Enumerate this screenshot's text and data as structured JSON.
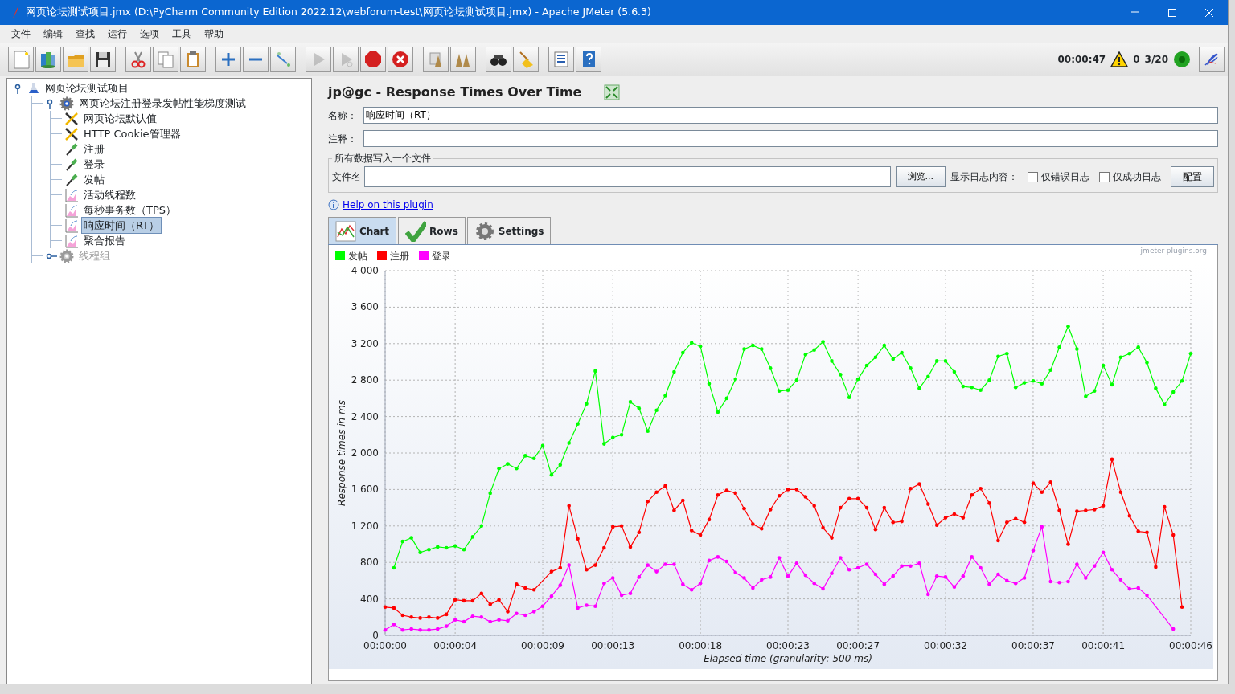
{
  "window": {
    "title": "网页论坛测试项目.jmx (D:\\PyCharm Community Edition 2022.12\\webforum-test\\网页论坛测试项目.jmx) - Apache JMeter (5.6.3)"
  },
  "menu": [
    "文件",
    "编辑",
    "查找",
    "运行",
    "选项",
    "工具",
    "帮助"
  ],
  "toolbar": [
    {
      "buttons": [
        {
          "kind": "new",
          "disabled": false
        },
        {
          "kind": "templates",
          "disabled": false
        },
        {
          "kind": "open",
          "disabled": false
        },
        {
          "kind": "save",
          "disabled": false
        }
      ]
    },
    {
      "buttons": [
        {
          "kind": "cut",
          "disabled": false
        },
        {
          "kind": "copy",
          "disabled": false
        },
        {
          "kind": "paste",
          "disabled": false
        }
      ]
    },
    {
      "buttons": [
        {
          "kind": "expand",
          "disabled": false
        },
        {
          "kind": "collapse",
          "disabled": false
        },
        {
          "kind": "toggle",
          "disabled": false
        }
      ]
    },
    {
      "buttons": [
        {
          "kind": "start",
          "disabled": true
        },
        {
          "kind": "start-no-pause",
          "disabled": true
        },
        {
          "kind": "stop",
          "disabled": false
        },
        {
          "kind": "shutdown",
          "disabled": false
        }
      ]
    },
    {
      "buttons": [
        {
          "kind": "clear",
          "disabled": false
        },
        {
          "kind": "clear-all",
          "disabled": false
        }
      ]
    },
    {
      "buttons": [
        {
          "kind": "search",
          "disabled": false
        },
        {
          "kind": "reset-search",
          "disabled": false
        }
      ]
    },
    {
      "buttons": [
        {
          "kind": "functions",
          "disabled": false
        },
        {
          "kind": "help",
          "disabled": false
        }
      ]
    }
  ],
  "status": {
    "elapsed": "00:00:47",
    "warnings": "0",
    "threads": "3/20",
    "running": true
  },
  "tree": [
    {
      "label": "网页论坛测试项目",
      "kind": "test-plan",
      "expanded": true,
      "selected": false,
      "disabled": false,
      "children": [
        {
          "label": "网页论坛注册登录发帖性能梯度测试",
          "kind": "thread-group",
          "expanded": true,
          "selected": false,
          "disabled": false,
          "children": [
            {
              "label": "网页论坛默认值",
              "kind": "config",
              "selected": false,
              "disabled": false
            },
            {
              "label": "HTTP Cookie管理器",
              "kind": "config",
              "selected": false,
              "disabled": false
            },
            {
              "label": "注册",
              "kind": "sampler",
              "selected": false,
              "disabled": false
            },
            {
              "label": "登录",
              "kind": "sampler",
              "selected": false,
              "disabled": false
            },
            {
              "label": "发帖",
              "kind": "sampler",
              "selected": false,
              "disabled": false
            },
            {
              "label": "活动线程数",
              "kind": "listener",
              "selected": false,
              "disabled": false
            },
            {
              "label": "每秒事务数（TPS）",
              "kind": "listener",
              "selected": false,
              "disabled": false
            },
            {
              "label": "响应时间（RT）",
              "kind": "listener",
              "selected": true,
              "disabled": false
            },
            {
              "label": "聚合报告",
              "kind": "listener",
              "selected": false,
              "disabled": false
            }
          ]
        },
        {
          "label": "线程组",
          "kind": "thread-group",
          "expanded": false,
          "selected": false,
          "disabled": true
        }
      ]
    }
  ],
  "panel": {
    "title": "jp@gc - Response Times Over Time",
    "name_label": "名称：",
    "name": "响应时间（RT）",
    "comment_label": "注释：",
    "file_group": {
      "legend": "所有数据写入一个文件",
      "file_label": "文件名",
      "browse_button": "浏览...",
      "log_label": "显示日志内容：",
      "options": [
        {
          "label": "仅错误日志",
          "checked": false
        },
        {
          "label": "仅成功日志",
          "checked": false
        }
      ],
      "configure_button": "配置"
    },
    "help_link": "Help on this plugin",
    "tabs": [
      {
        "label": "Chart",
        "kind": "chart",
        "selected": true
      },
      {
        "label": "Rows",
        "kind": "rows",
        "selected": false
      },
      {
        "label": "Settings",
        "kind": "settings",
        "selected": false
      }
    ],
    "chart": {
      "watermark": "jmeter-plugins.org",
      "chart_data": {
        "type": "line",
        "xlabel": "Elapsed time (granularity: 500 ms)",
        "ylabel": "Response times in ms",
        "grid": true,
        "legend": "top-left",
        "x": [
          0,
          0.5,
          1,
          1.5,
          2,
          2.5,
          3,
          3.5,
          4,
          4.5,
          5,
          5.5,
          6,
          6.5,
          7,
          7.5,
          8,
          8.5,
          9,
          9.5,
          10,
          10.5,
          11,
          11.5,
          12,
          12.5,
          13,
          13.5,
          14,
          14.5,
          15,
          15.5,
          16,
          16.5,
          17,
          17.5,
          18,
          18.5,
          19,
          19.5,
          20,
          20.5,
          21,
          21.5,
          22,
          22.5,
          23,
          23.5,
          24,
          24.5,
          25,
          25.5,
          26,
          26.5,
          27,
          27.5,
          28,
          28.5,
          29,
          29.5,
          30,
          30.5,
          31,
          31.5,
          32,
          32.5,
          33,
          33.5,
          34,
          34.5,
          35,
          35.5,
          36,
          36.5,
          37,
          37.5,
          38,
          38.5,
          39,
          39.5,
          40,
          40.5,
          41,
          41.5,
          42,
          42.5,
          43,
          43.5,
          44,
          44.5,
          45,
          45.5,
          46
        ],
        "xlim": [
          0,
          46
        ],
        "ylim": [
          0,
          4000
        ],
        "xticks": [
          {
            "value": 0,
            "label": "00:00:00"
          },
          {
            "value": 4,
            "label": "00:00:04"
          },
          {
            "value": 9,
            "label": "00:00:09"
          },
          {
            "value": 13,
            "label": "00:00:13"
          },
          {
            "value": 18,
            "label": "00:00:18"
          },
          {
            "value": 23,
            "label": "00:00:23"
          },
          {
            "value": 27,
            "label": "00:00:27"
          },
          {
            "value": 32,
            "label": "00:00:32"
          },
          {
            "value": 37,
            "label": "00:00:37"
          },
          {
            "value": 41,
            "label": "00:00:41"
          },
          {
            "value": 46,
            "label": "00:00:46"
          }
        ],
        "yticks": [
          {
            "value": 0,
            "label": "0"
          },
          {
            "value": 400,
            "label": "400"
          },
          {
            "value": 800,
            "label": "800"
          },
          {
            "value": 1200,
            "label": "1 200"
          },
          {
            "value": 1600,
            "label": "1 600"
          },
          {
            "value": 2000,
            "label": "2 000"
          },
          {
            "value": 2400,
            "label": "2 400"
          },
          {
            "value": 2800,
            "label": "2 800"
          },
          {
            "value": 3200,
            "label": "3 200"
          },
          {
            "value": 3600,
            "label": "3 600"
          },
          {
            "value": 4000,
            "label": "4 000"
          }
        ],
        "series": [
          {
            "name": "发帖",
            "color": "#00ff00",
            "values": [
              null,
              740,
              1030,
              1070,
              910,
              940,
              970,
              960,
              980,
              940,
              1080,
              1200,
              1560,
              1830,
              1880,
              1830,
              1970,
              1940,
              2080,
              1760,
              1870,
              2110,
              2320,
              2540,
              2900,
              2100,
              2170,
              2200,
              2560,
              2490,
              2240,
              2470,
              2630,
              2890,
              3100,
              3210,
              3170,
              2760,
              2450,
              2600,
              2810,
              3140,
              3180,
              3140,
              2930,
              2680,
              2690,
              2800,
              3080,
              3130,
              3220,
              3010,
              2860,
              2610,
              2810,
              2960,
              3050,
              3180,
              3030,
              3100,
              2930,
              2710,
              2840,
              3010,
              3010,
              2890,
              2730,
              2720,
              2690,
              2800,
              3060,
              3090,
              2720,
              2770,
              2790,
              2760,
              2910,
              3160,
              3390,
              3140,
              2620,
              2680,
              2960,
              2750,
              3050,
              3090,
              3160,
              2990,
              2710,
              2530,
              2670,
              2790,
              3090
            ]
          },
          {
            "name": "注册",
            "color": "#ff0000",
            "values": [
              310,
              300,
              220,
              200,
              190,
              200,
              190,
              230,
              390,
              380,
              380,
              460,
              340,
              390,
              260,
              560,
              520,
              500,
              null,
              700,
              740,
              1420,
              1060,
              720,
              770,
              960,
              1190,
              1200,
              970,
              1130,
              1470,
              1570,
              1640,
              1370,
              1480,
              1150,
              1100,
              1270,
              1540,
              1590,
              1560,
              1390,
              1220,
              1170,
              1380,
              1530,
              1600,
              1600,
              1520,
              1420,
              1180,
              1070,
              1400,
              1500,
              1500,
              1400,
              1160,
              1400,
              1240,
              1250,
              1610,
              1660,
              1440,
              1210,
              1290,
              1330,
              1290,
              1540,
              1610,
              1450,
              1040,
              1240,
              1280,
              1240,
              1670,
              1570,
              1680,
              1370,
              1000,
              1360,
              1370,
              1380,
              1420,
              1930,
              1570,
              1310,
              1140,
              1130,
              750,
              1410,
              1100,
              310,
              null
            ]
          },
          {
            "name": "登录",
            "color": "#ff00ff",
            "values": [
              60,
              120,
              60,
              70,
              60,
              60,
              70,
              100,
              170,
              150,
              210,
              200,
              150,
              170,
              160,
              240,
              220,
              260,
              320,
              430,
              550,
              770,
              300,
              330,
              320,
              570,
              630,
              440,
              460,
              640,
              770,
              700,
              780,
              780,
              560,
              500,
              570,
              820,
              860,
              810,
              690,
              630,
              520,
              610,
              640,
              850,
              650,
              790,
              660,
              570,
              510,
              680,
              850,
              720,
              740,
              780,
              670,
              560,
              650,
              760,
              760,
              790,
              450,
              650,
              640,
              530,
              650,
              860,
              740,
              560,
              670,
              600,
              570,
              630,
              930,
              1190,
              590,
              580,
              590,
              780,
              630,
              760,
              910,
              720,
              610,
              510,
              520,
              440,
              null,
              null,
              70,
              null,
              null
            ]
          }
        ]
      }
    }
  }
}
